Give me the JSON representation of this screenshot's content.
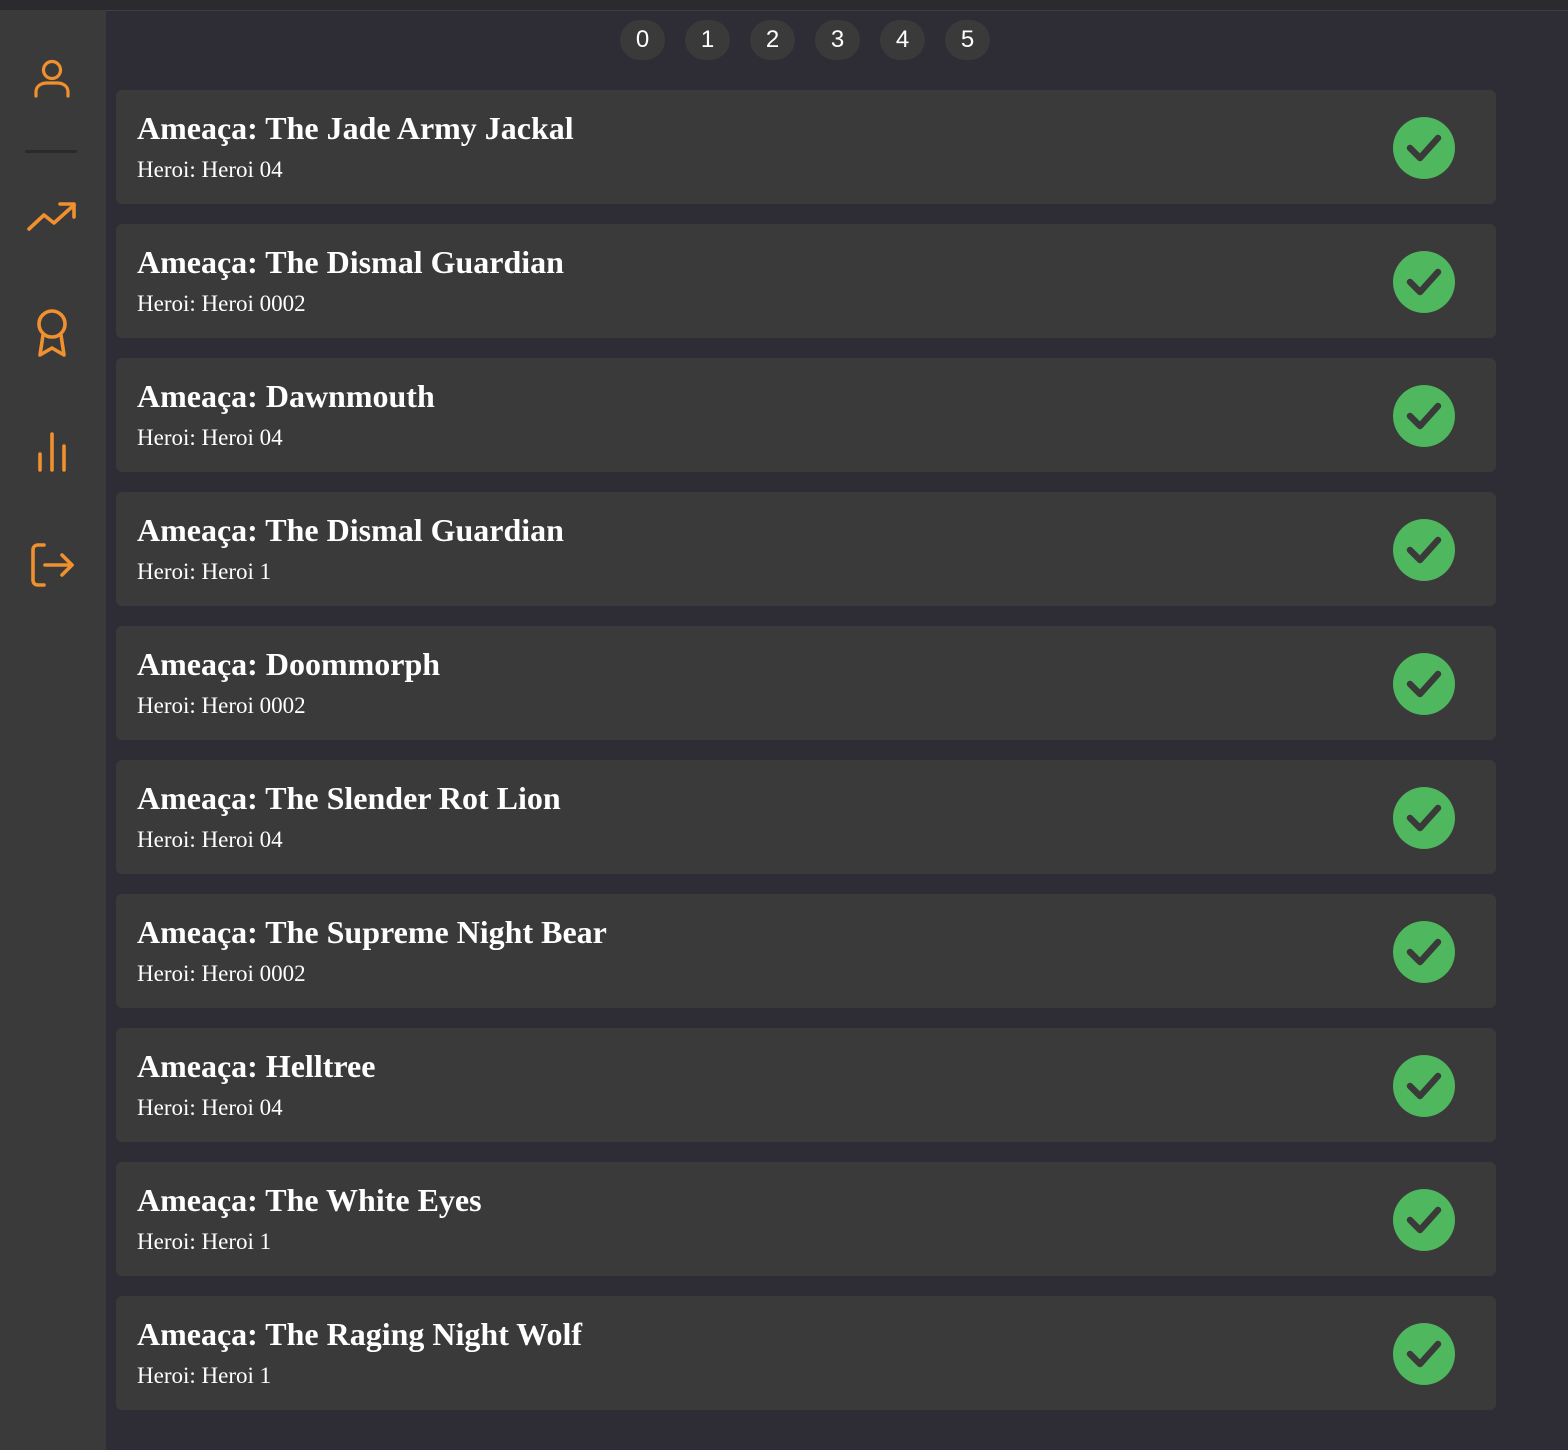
{
  "colors": {
    "background": "#2e2c34",
    "card": "#3a3a3a",
    "sidebar": "#3a3a3a",
    "accent": "#f0902e",
    "success": "#4fb75e"
  },
  "sidebar": {
    "items": [
      {
        "icon": "user-icon"
      },
      {
        "icon": "trending-up-icon"
      },
      {
        "icon": "award-icon"
      },
      {
        "icon": "bar-chart-icon"
      },
      {
        "icon": "logout-icon"
      }
    ]
  },
  "pagination": {
    "pages": [
      "0",
      "1",
      "2",
      "3",
      "4",
      "5"
    ]
  },
  "threats": [
    {
      "title": "Ameaça: The Jade Army Jackal",
      "hero": "Heroi: Heroi 04",
      "status_icon": "check-circle-icon"
    },
    {
      "title": "Ameaça: The Dismal Guardian",
      "hero": "Heroi: Heroi 0002",
      "status_icon": "check-circle-icon"
    },
    {
      "title": "Ameaça: Dawnmouth",
      "hero": "Heroi: Heroi 04",
      "status_icon": "check-circle-icon"
    },
    {
      "title": "Ameaça: The Dismal Guardian",
      "hero": "Heroi: Heroi 1",
      "status_icon": "check-circle-icon"
    },
    {
      "title": "Ameaça: Doommorph",
      "hero": "Heroi: Heroi 0002",
      "status_icon": "check-circle-icon"
    },
    {
      "title": "Ameaça: The Slender Rot Lion",
      "hero": "Heroi: Heroi 04",
      "status_icon": "check-circle-icon"
    },
    {
      "title": "Ameaça: The Supreme Night Bear",
      "hero": "Heroi: Heroi 0002",
      "status_icon": "check-circle-icon"
    },
    {
      "title": "Ameaça: Helltree",
      "hero": "Heroi: Heroi 04",
      "status_icon": "check-circle-icon"
    },
    {
      "title": "Ameaça: The White Eyes",
      "hero": "Heroi: Heroi 1",
      "status_icon": "check-circle-icon"
    },
    {
      "title": "Ameaça: The Raging Night Wolf",
      "hero": "Heroi: Heroi 1",
      "status_icon": "check-circle-icon"
    }
  ]
}
